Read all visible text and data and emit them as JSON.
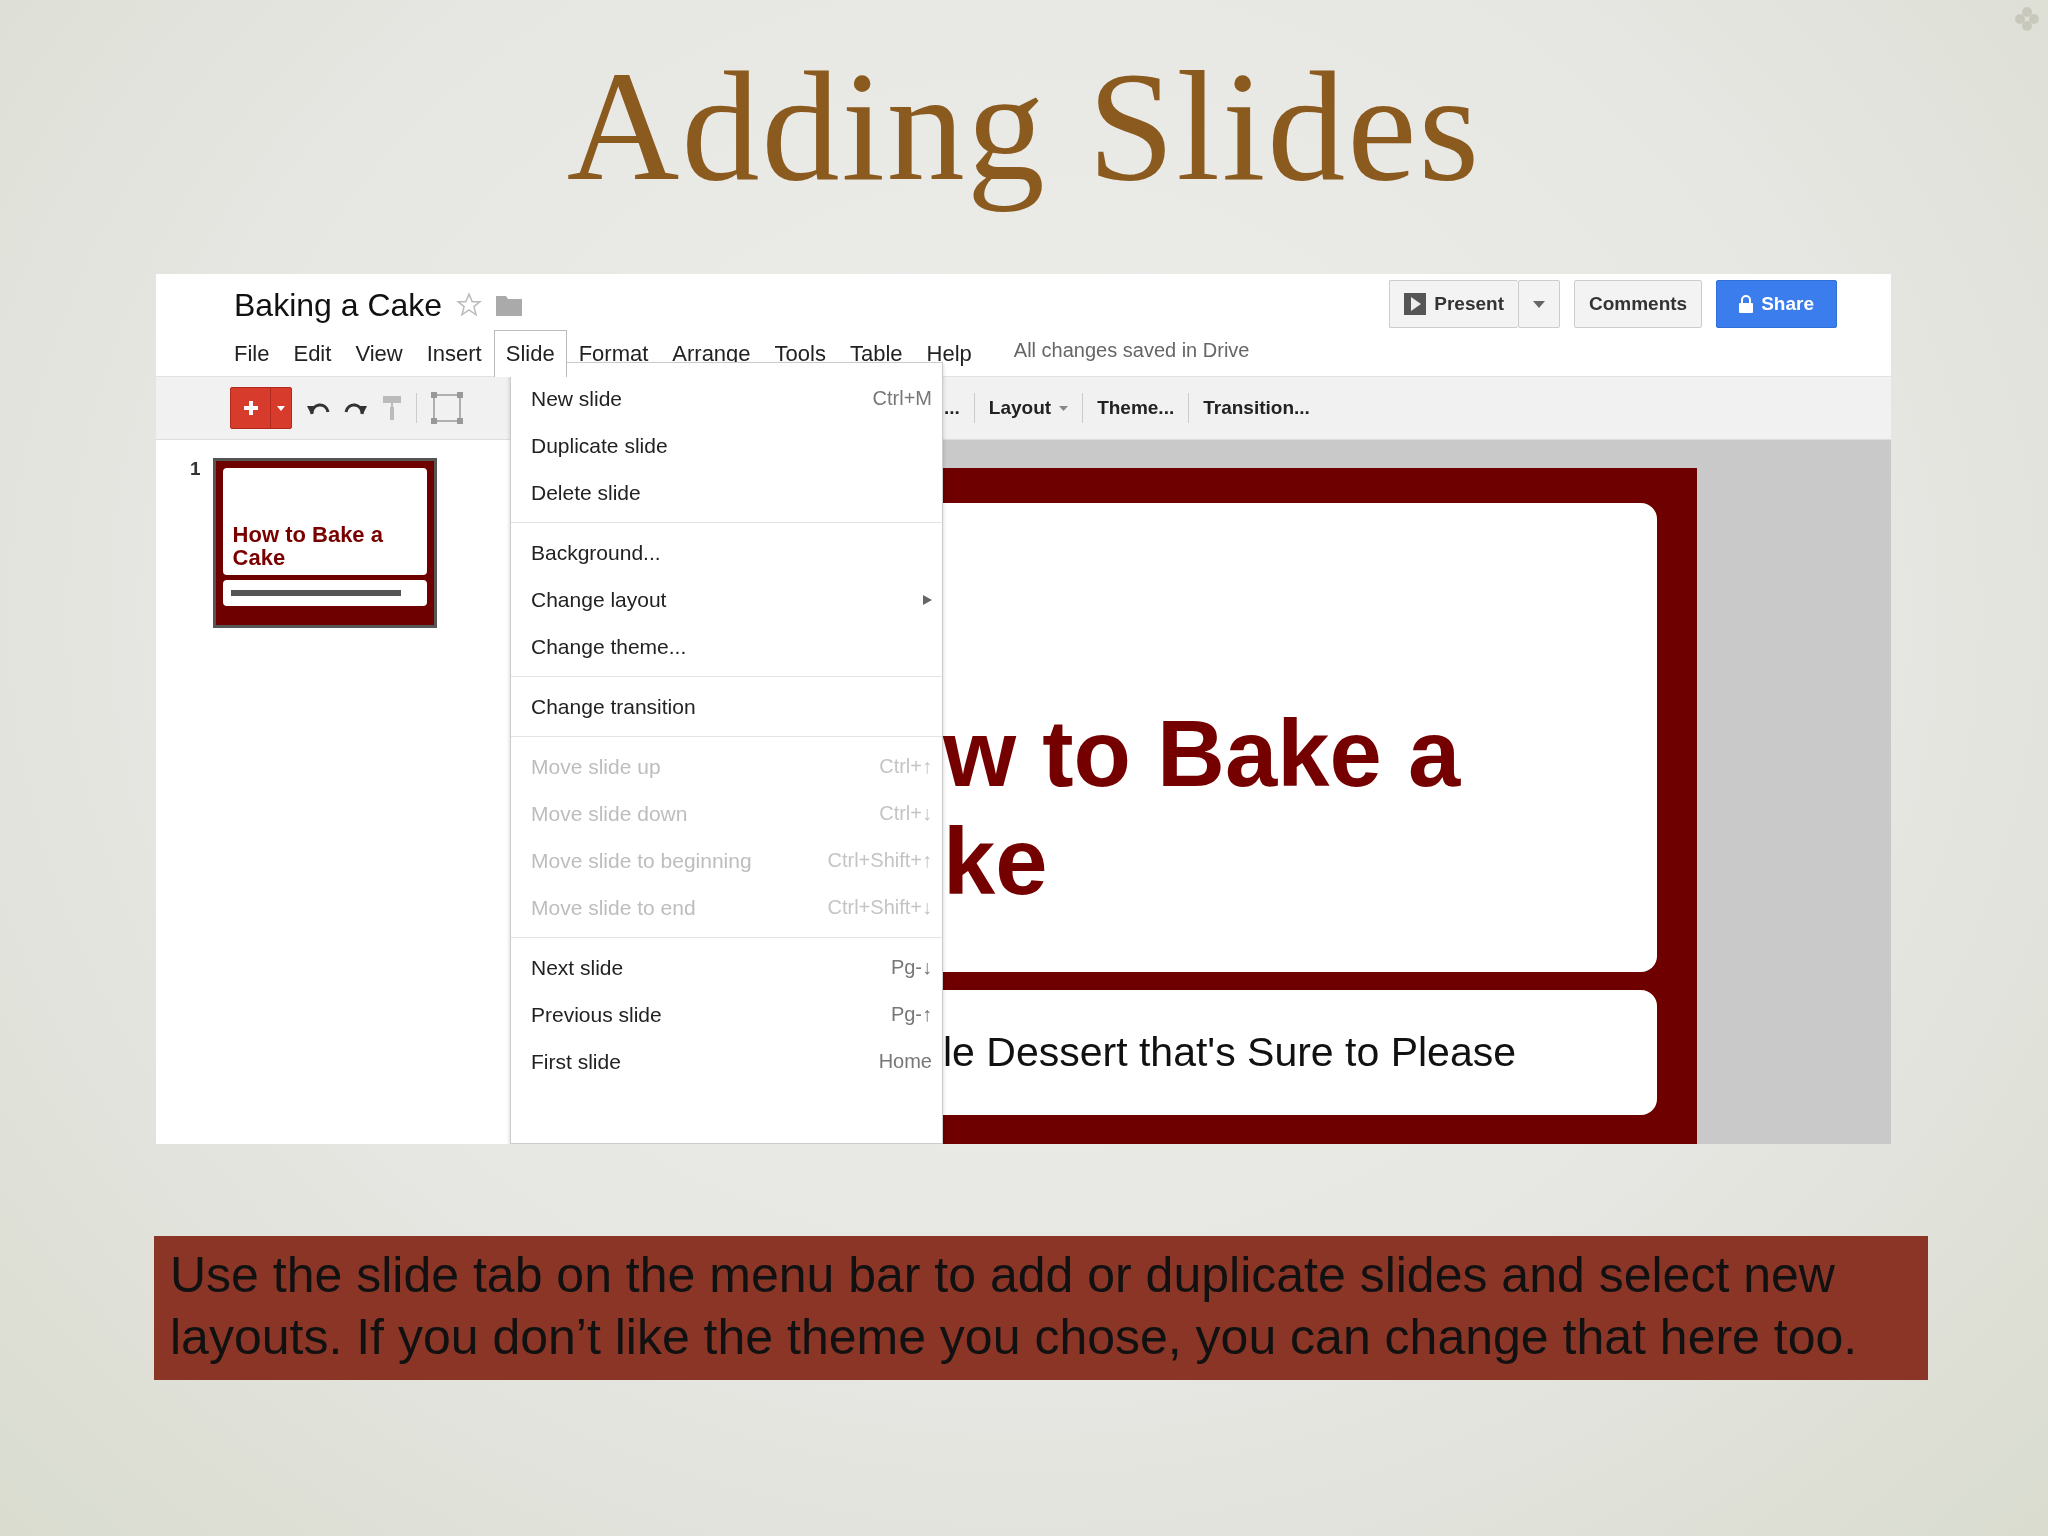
{
  "slide_title": "Adding Slides",
  "app": {
    "doc_title": "Baking a Cake",
    "starred": false,
    "menus": [
      {
        "label": "File",
        "selected": false
      },
      {
        "label": "Edit",
        "selected": false
      },
      {
        "label": "View",
        "selected": false
      },
      {
        "label": "Insert",
        "selected": false
      },
      {
        "label": "Slide",
        "selected": true
      },
      {
        "label": "Format",
        "selected": false
      },
      {
        "label": "Arrange",
        "selected": false
      },
      {
        "label": "Tools",
        "selected": false
      },
      {
        "label": "Table",
        "selected": false
      },
      {
        "label": "Help",
        "selected": false
      }
    ],
    "save_status": "All changes saved in Drive",
    "present": "Present",
    "comments": "Comments",
    "share": "Share",
    "toolbar_overflow": "...",
    "toolbar_items": [
      {
        "label": "Layout",
        "kind": "dropdown"
      },
      {
        "label": "Theme...",
        "kind": "button"
      },
      {
        "label": "Transition...",
        "kind": "button"
      }
    ],
    "filmstrip": [
      {
        "number": "1",
        "title": "How to Bake a Cake",
        "selected": true
      }
    ],
    "slide_menu": [
      [
        {
          "label": "New slide",
          "shortcut": "Ctrl+M",
          "kind": "item",
          "disabled": false
        },
        {
          "label": "Duplicate slide",
          "kind": "item",
          "disabled": false
        },
        {
          "label": "Delete slide",
          "kind": "item",
          "disabled": false
        }
      ],
      [
        {
          "label": "Background...",
          "kind": "item",
          "disabled": false
        },
        {
          "label": "Change layout",
          "kind": "submenu",
          "disabled": false
        },
        {
          "label": "Change theme...",
          "kind": "item",
          "disabled": false
        }
      ],
      [
        {
          "label": "Change transition",
          "kind": "item",
          "disabled": false
        }
      ],
      [
        {
          "label": "Move slide up",
          "shortcut": "Ctrl+↑",
          "kind": "item",
          "disabled": true
        },
        {
          "label": "Move slide down",
          "shortcut": "Ctrl+↓",
          "kind": "item",
          "disabled": true
        },
        {
          "label": "Move slide to beginning",
          "shortcut": "Ctrl+Shift+↑",
          "kind": "item",
          "disabled": true
        },
        {
          "label": "Move slide to end",
          "shortcut": "Ctrl+Shift+↓",
          "kind": "item",
          "disabled": true
        }
      ],
      [
        {
          "label": "Next slide",
          "shortcut": "Pg-↓",
          "kind": "item",
          "disabled": false
        },
        {
          "label": "Previous slide",
          "shortcut": "Pg-↑",
          "kind": "item",
          "disabled": false
        },
        {
          "label": "First slide",
          "shortcut": "Home",
          "kind": "item",
          "disabled": false
        }
      ]
    ],
    "canvas_slide": {
      "title_lines": [
        "w to Bake a",
        "ke"
      ],
      "subtitle": "le Dessert that's Sure to Please"
    }
  },
  "caption": "Use the slide tab on the menu bar to add or duplicate slides and select new layouts. If you don’t like the theme you chose, you can change that here too."
}
